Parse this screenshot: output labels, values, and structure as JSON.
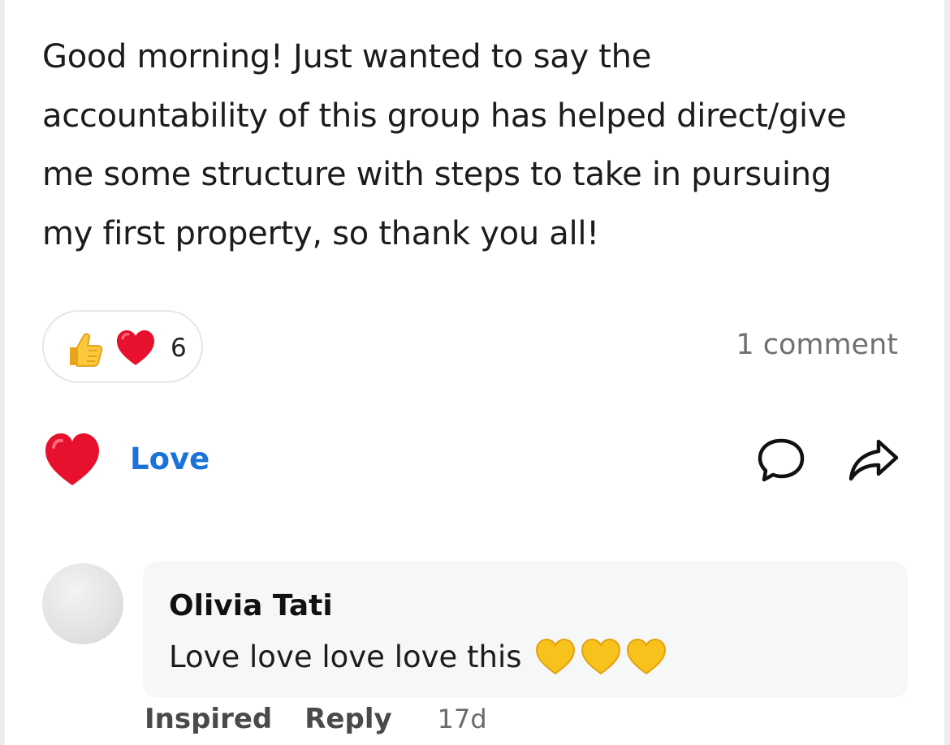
{
  "post": {
    "text": "Good morning! Just wanted to say the\naccountability of this group has helped direct/give\nme some structure with steps to take in pursuing\nmy first property, so thank you all!"
  },
  "reactions": {
    "icons": [
      "thumbs-up-icon",
      "red-heart-icon"
    ],
    "count": "6"
  },
  "comments_summary": {
    "label": "1 comment"
  },
  "actions": {
    "reaction_label": "Love",
    "reaction_icon": "red-heart-icon",
    "comment_icon": "speech-bubble-icon",
    "share_icon": "share-arrow-icon"
  },
  "comment": {
    "author": "Olivia Tati",
    "text": "Love love love love this",
    "emojis": [
      "yellow-heart-icon",
      "yellow-heart-icon",
      "yellow-heart-icon"
    ],
    "reaction_action": "Inspired",
    "reply_action": "Reply",
    "time": "17d"
  },
  "colors": {
    "accent": "#1a73d8",
    "heart": "#e8112d",
    "yellow_heart": "#f7c21b",
    "bubble_bg": "#f6f7f7"
  }
}
